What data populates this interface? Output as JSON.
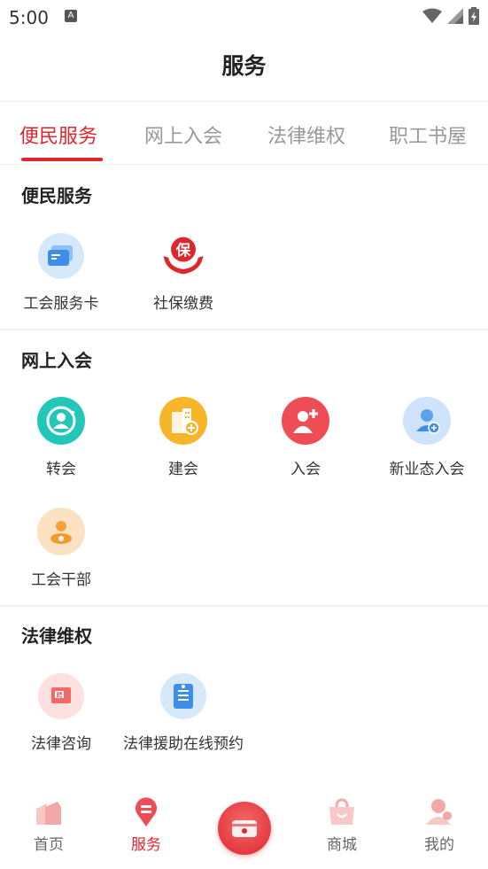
{
  "status_bar": {
    "time": "5:00",
    "notification_icon": "A"
  },
  "header": {
    "title": "服务"
  },
  "tabs": [
    {
      "label": "便民服务",
      "active": true
    },
    {
      "label": "网上入会",
      "active": false
    },
    {
      "label": "法律维权",
      "active": false
    },
    {
      "label": "职工书屋",
      "active": false
    }
  ],
  "sections": {
    "convenience": {
      "title": "便民服务",
      "items": [
        {
          "label": "工会服务卡",
          "icon": "card-icon"
        },
        {
          "label": "社保缴费",
          "icon": "insurance-icon"
        }
      ]
    },
    "join": {
      "title": "网上入会",
      "items": [
        {
          "label": "转会",
          "icon": "transfer-icon"
        },
        {
          "label": "建会",
          "icon": "building-icon"
        },
        {
          "label": "入会",
          "icon": "add-member-icon"
        },
        {
          "label": "新业态入会",
          "icon": "new-business-icon"
        },
        {
          "label": "工会干部",
          "icon": "cadre-icon"
        }
      ]
    },
    "legal": {
      "title": "法律维权",
      "items": [
        {
          "label": "法律咨询",
          "icon": "consult-icon"
        },
        {
          "label": "法律援助在线预约",
          "icon": "legal-aid-icon"
        }
      ]
    }
  },
  "bottom_nav": [
    {
      "label": "首页",
      "icon": "home-icon",
      "active": false
    },
    {
      "label": "服务",
      "icon": "service-icon",
      "active": true
    },
    {
      "label": "商城",
      "icon": "shop-icon",
      "active": false
    },
    {
      "label": "我的",
      "icon": "profile-icon",
      "active": false
    }
  ],
  "colors": {
    "accent": "#e0262d",
    "inactive_tab": "#999999"
  }
}
